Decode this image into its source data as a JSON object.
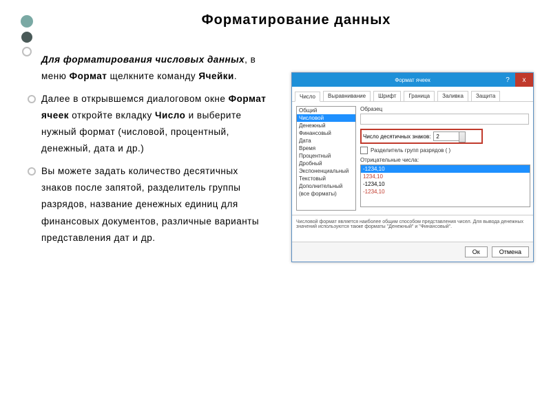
{
  "title": "Форматирование  данных",
  "dots": [
    {
      "size": 18,
      "bg": "#7aa9a4"
    },
    {
      "size": 16,
      "bg": "#4a5a58"
    },
    {
      "size": 12,
      "bg": "#ffffff",
      "border": "#bfbfbf"
    }
  ],
  "bullets": {
    "p1": {
      "t1": "Для  форматирования  числовых  данных",
      "t2": ",  в  меню ",
      "t3": "Формат",
      "t4": "  щелкните команду ",
      "t5": "Ячейки",
      "t6": "."
    },
    "p2": {
      "t1": "Далее  в  открывшемся  диалоговом окне ",
      "t2": "Формат  ячеек",
      "t3": "  откройте вкладку ",
      "t4": "Число",
      "t5": "  и  выберите  нужный формат  (числовой,  процентный,  денежный,  дата  и  др.)"
    },
    "p3": "Вы  можете  задать  количество десятичных  знаков  после  запятой, разделитель  группы  разрядов, название  денежных  единиц  для финансовых  документов,  различные варианты  представления  дат  и  др."
  },
  "dialog": {
    "title": "Формат ячеек",
    "help": "?",
    "close": "x",
    "tabs": [
      "Число",
      "Выравнивание",
      "Шрифт",
      "Граница",
      "Заливка",
      "Защита"
    ],
    "active_tab": 0,
    "sample_label": "Образец",
    "formats": [
      "Общий",
      "Числовой",
      "Денежный",
      "Финансовый",
      "Дата",
      "Время",
      "Процентный",
      "Дробный",
      "Экспоненциальный",
      "Текстовый",
      "Дополнительный",
      "(все форматы)"
    ],
    "selected_format": 1,
    "decimal_label": "Число десятичных знаков:",
    "decimal_value": "2",
    "group_sep_label": "Разделитель групп разрядов ( )",
    "neg_label": "Отрицательные числа:",
    "neg_samples": [
      "-1234,10",
      "1234,10",
      "-1234,10",
      "-1234,10"
    ],
    "description": "Числовой формат является наиболее общим способом представления чисел. Для вывода денежных значений используются также форматы \"Денежный\" и \"Финансовый\".",
    "ok": "Ок",
    "cancel": "Отмена"
  }
}
